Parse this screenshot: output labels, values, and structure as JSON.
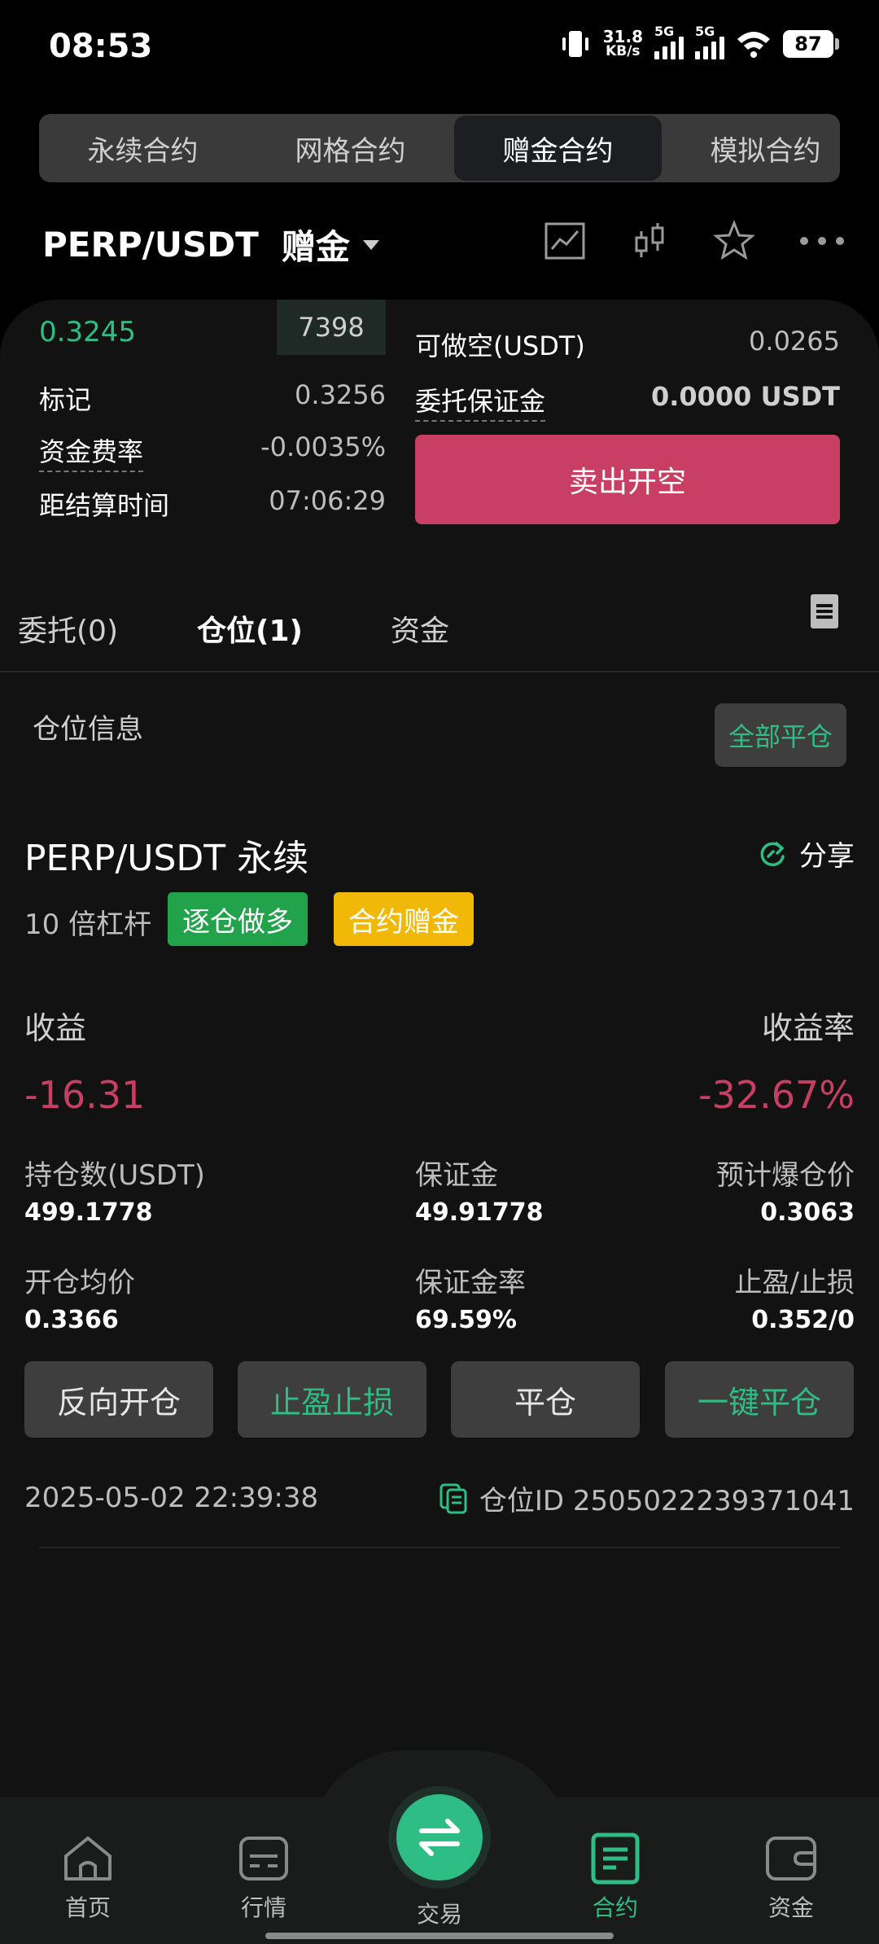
{
  "status_bar": {
    "time": "08:53",
    "net_speed_value": "31.8",
    "net_speed_unit": "KB/s",
    "sim1": "5G",
    "sim2": "5G",
    "battery": "87"
  },
  "contract_tabs": [
    {
      "label": "永续合约",
      "active": false
    },
    {
      "label": "网格合约",
      "active": false
    },
    {
      "label": "赠金合约",
      "active": true
    },
    {
      "label": "模拟合约",
      "active": false
    }
  ],
  "header": {
    "symbol": "PERP/USDT",
    "mode": "赠金",
    "icons": [
      "chart-icon",
      "candlestick-icon",
      "star-icon",
      "more-icon"
    ]
  },
  "trade_panel": {
    "last_price": "0.3245",
    "orderbook_value": "7398",
    "mark_label": "标记",
    "mark_value": "0.3256",
    "funding_label": "资金费率",
    "funding_value": "-0.0035%",
    "settle_label": "距结算时间",
    "settle_value": "07:06:29",
    "available_label": "可做空(USDT)",
    "available_value": "0.0265",
    "margin_label": "委托保证金",
    "margin_value": "0.0000 USDT",
    "sell_button": "卖出开空"
  },
  "position_tabs": [
    {
      "label": "委托(0)",
      "active": false
    },
    {
      "label": "仓位(1)",
      "active": true
    },
    {
      "label": "资金",
      "active": false
    }
  ],
  "positions": {
    "section_title": "仓位信息",
    "close_all": "全部平仓",
    "name": "PERP/USDT 永续",
    "share": "分享",
    "leverage": "10 倍杠杆",
    "badge_side": "逐仓做多",
    "badge_bonus": "合约赠金",
    "pnl_label": "收益",
    "pnl_value": "-16.31",
    "roe_label": "收益率",
    "roe_value": "-32.67%",
    "size_label": "持仓数(USDT)",
    "size_value": "499.1778",
    "margin_label": "保证金",
    "margin_value": "49.91778",
    "liq_label": "预计爆仓价",
    "liq_value": "0.3063",
    "entry_label": "开仓均价",
    "entry_value": "0.3366",
    "margin_rate_label": "保证金率",
    "margin_rate_value": "69.59%",
    "tpsl_label": "止盈/止损",
    "tpsl_value": "0.352/0",
    "btn_reverse": "反向开仓",
    "btn_tpsl": "止盈止损",
    "btn_close": "平仓",
    "btn_quick_close": "一键平仓",
    "timestamp": "2025-05-02 22:39:38",
    "position_id": "仓位ID 2505022239371041"
  },
  "bottom_nav": [
    {
      "label": "首页",
      "icon": "home-icon"
    },
    {
      "label": "行情",
      "icon": "market-icon"
    },
    {
      "label": "交易",
      "icon": "swap-icon"
    },
    {
      "label": "合约",
      "icon": "contract-icon"
    },
    {
      "label": "资金",
      "icon": "wallet-icon"
    }
  ],
  "colors": {
    "green": "#2ebd85",
    "red": "#c93f63",
    "yellow": "#f2b807",
    "badge_green": "#22a34b"
  }
}
